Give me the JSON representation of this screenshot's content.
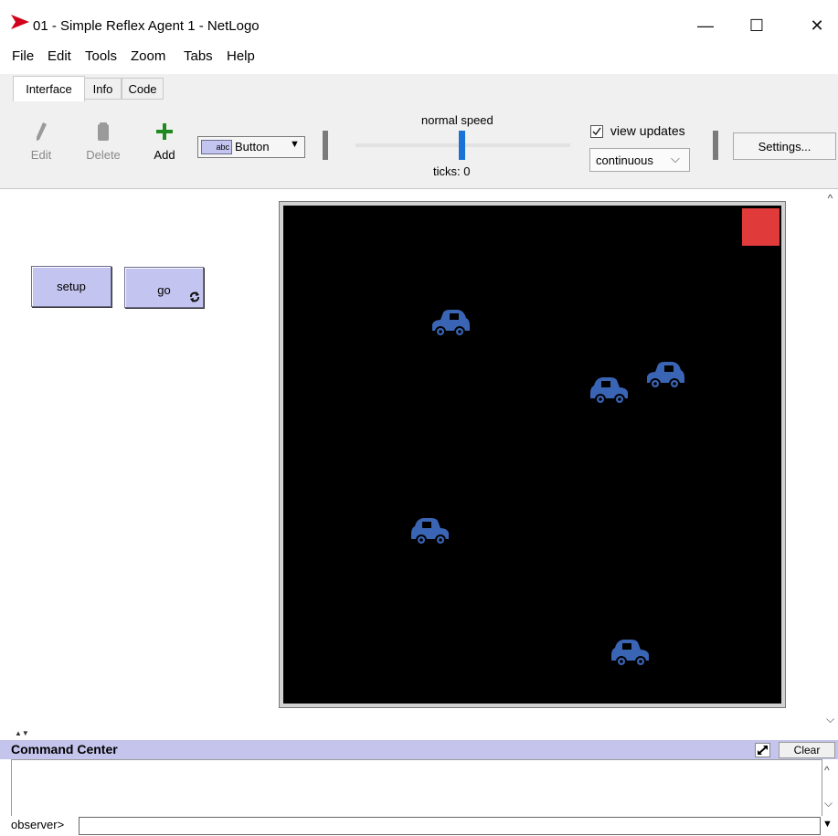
{
  "window": {
    "title": "01 - Simple Reflex Agent 1 - NetLogo",
    "minimize_glyph": "—",
    "maximize_glyph": "☐",
    "close_glyph": "✕",
    "logo_color": "#d0021b"
  },
  "menu": [
    "File",
    "Edit",
    "Tools",
    "Zoom",
    "Tabs",
    "Help"
  ],
  "tabs": [
    {
      "label": "Interface",
      "active": true
    },
    {
      "label": "Info",
      "active": false
    },
    {
      "label": "Code",
      "active": false
    }
  ],
  "toolbar": {
    "edit_label": "Edit",
    "delete_label": "Delete",
    "add_label": "Add",
    "widget_type": "Button",
    "widget_type_icon_text": "abc",
    "speed_label": "normal speed",
    "speed_fraction": 0.5,
    "ticks_label": "ticks: 0",
    "view_updates_label": "view updates",
    "view_updates_checked": true,
    "update_mode": "continuous",
    "settings_label": "Settings..."
  },
  "interface": {
    "setup_label": "setup",
    "go_label": "go",
    "go_forever_icon": "forever-arrows-icon",
    "widget_color": "#c4c4f0"
  },
  "world": {
    "background": "#000000",
    "patch_color": "#e03a3a",
    "turtle_shape": "car",
    "turtle_color": "#3a64b4",
    "turtle_count": 5
  },
  "command_center": {
    "title": "Command Center",
    "clear_label": "Clear",
    "prompt": "observer>",
    "expand_icon": "expand-arrows-icon"
  }
}
